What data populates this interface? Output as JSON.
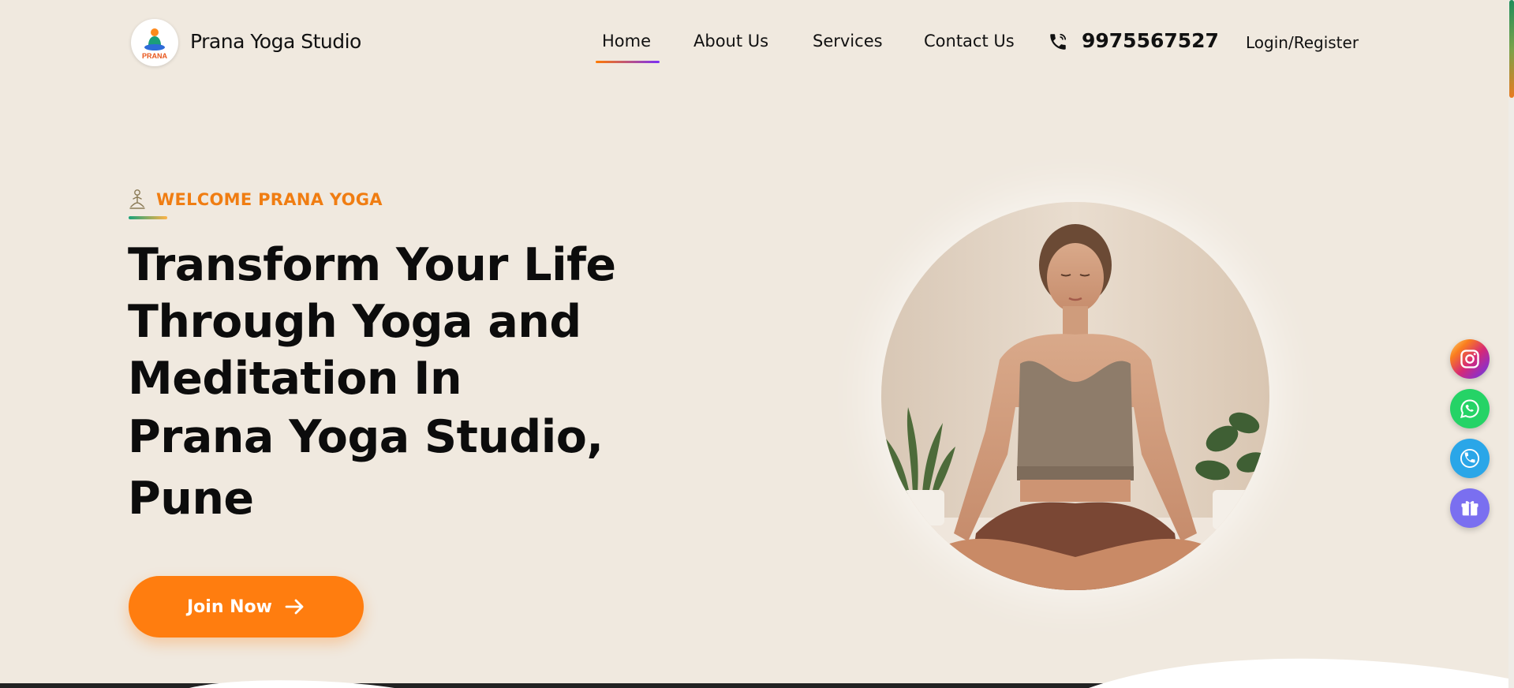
{
  "header": {
    "logo_text": "PRANA",
    "brand": "Prana Yoga Studio",
    "nav": [
      {
        "label": "Home",
        "active": true
      },
      {
        "label": "About Us"
      },
      {
        "label": "Services"
      },
      {
        "label": "Contact Us"
      }
    ],
    "phone": "9975567527",
    "login_label": "Login/Register",
    "phone_icon": "phone-icon"
  },
  "hero": {
    "eyebrow": "WELCOME PRANA YOGA",
    "eyebrow_icon": "meditation-icon",
    "headline_lines": [
      "Transform Your Life",
      "Through Yoga and",
      "Meditation In",
      "Prana Yoga Studio,",
      "Pune"
    ],
    "cta_label": "Join Now",
    "cta_icon": "arrow-right-icon",
    "image": "woman-meditating-photo"
  },
  "social": [
    {
      "name": "instagram-icon",
      "color": "#dd2a7b"
    },
    {
      "name": "whatsapp-icon",
      "color": "#25d366"
    },
    {
      "name": "phone-icon",
      "color": "#2aa6e8"
    },
    {
      "name": "gift-icon",
      "color": "#7a6ff0"
    }
  ],
  "colors": {
    "accent": "#ff7d0f",
    "background": "#f0e9df",
    "eyebrow": "#f07d12"
  }
}
